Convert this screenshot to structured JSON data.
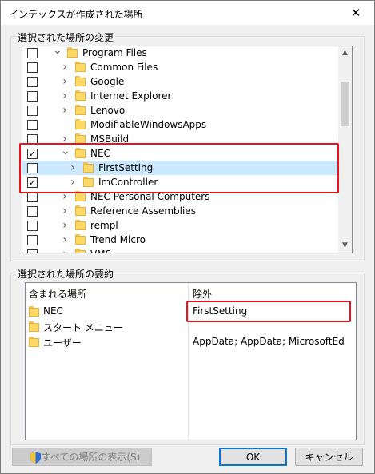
{
  "window": {
    "title": "インデックスが作成された場所",
    "close_glyph": "✕"
  },
  "selected_locations": {
    "group_label": "選択された場所の変更",
    "rows": [
      {
        "label": "Program Files",
        "checked": false,
        "expander": "v",
        "indent": 0,
        "selected": false
      },
      {
        "label": "Common Files",
        "checked": false,
        "expander": ">",
        "indent": 1,
        "selected": false
      },
      {
        "label": "Google",
        "checked": false,
        "expander": ">",
        "indent": 1,
        "selected": false
      },
      {
        "label": "Internet Explorer",
        "checked": false,
        "expander": ">",
        "indent": 1,
        "selected": false
      },
      {
        "label": "Lenovo",
        "checked": false,
        "expander": ">",
        "indent": 1,
        "selected": false
      },
      {
        "label": "ModifiableWindowsApps",
        "checked": false,
        "expander": "",
        "indent": 1,
        "selected": false
      },
      {
        "label": "MSBuild",
        "checked": false,
        "expander": ">",
        "indent": 1,
        "selected": false
      },
      {
        "label": "NEC",
        "checked": true,
        "expander": "v",
        "indent": 1,
        "selected": false
      },
      {
        "label": "FirstSetting",
        "checked": false,
        "expander": ">",
        "indent": 2,
        "selected": true
      },
      {
        "label": "ImController",
        "checked": true,
        "expander": ">",
        "indent": 2,
        "selected": false
      },
      {
        "label": "NEC Personal Computers",
        "checked": false,
        "expander": ">",
        "indent": 1,
        "selected": false
      },
      {
        "label": "Reference Assemblies",
        "checked": false,
        "expander": ">",
        "indent": 1,
        "selected": false
      },
      {
        "label": "rempl",
        "checked": false,
        "expander": ">",
        "indent": 1,
        "selected": false
      },
      {
        "label": "Trend Micro",
        "checked": false,
        "expander": ">",
        "indent": 1,
        "selected": false
      },
      {
        "label": "VMS",
        "checked": false,
        "expander": ">",
        "indent": 1,
        "selected": false
      }
    ],
    "scroll_up": "▲",
    "scroll_down": "▼"
  },
  "summary": {
    "group_label": "選択された場所の要約",
    "included_header": "含まれる場所",
    "excluded_header": "除外",
    "included": [
      "NEC",
      "スタート メニュー",
      "ユーザー"
    ],
    "excluded": [
      "FirstSetting",
      "",
      "AppData; AppData; MicrosoftEdg..."
    ]
  },
  "buttons": {
    "show_all": "すべての場所の表示(S)",
    "ok": "OK",
    "cancel": "キャンセル"
  },
  "colors": {
    "highlight_red": "#e8131e",
    "selection_blue": "#cce8ff",
    "default_button_border": "#0078d7"
  }
}
